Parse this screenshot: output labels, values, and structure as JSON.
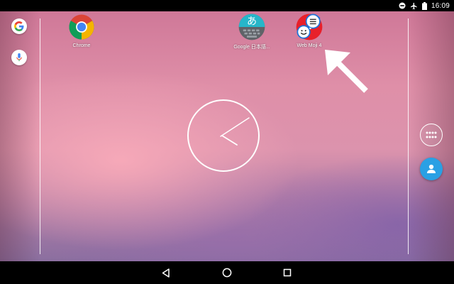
{
  "status_bar": {
    "time": "16:09",
    "icons": [
      "do-not-disturb-icon",
      "airplane-mode-icon",
      "battery-icon"
    ]
  },
  "search_widget": {
    "icons": [
      "google-g-icon",
      "microphone-icon"
    ]
  },
  "apps": [
    {
      "label": "Chrome",
      "icon": "chrome-icon"
    },
    {
      "label": "Google 日本語...",
      "icon": "google-japanese-input-icon",
      "glyph": "あ"
    },
    {
      "label": "Web Moji 4",
      "icon": "web-moji-icon"
    }
  ],
  "dock": {
    "icons": [
      "app-drawer-icon",
      "contacts-icon"
    ]
  },
  "nav_bar": {
    "icons": [
      "back-icon",
      "home-icon",
      "recents-icon"
    ]
  },
  "colors": {
    "contacts_blue": "#2aa0e4",
    "google_blue": "#4285F4",
    "google_red": "#EA4335",
    "google_yellow": "#FBBC05",
    "google_green": "#34A853"
  }
}
